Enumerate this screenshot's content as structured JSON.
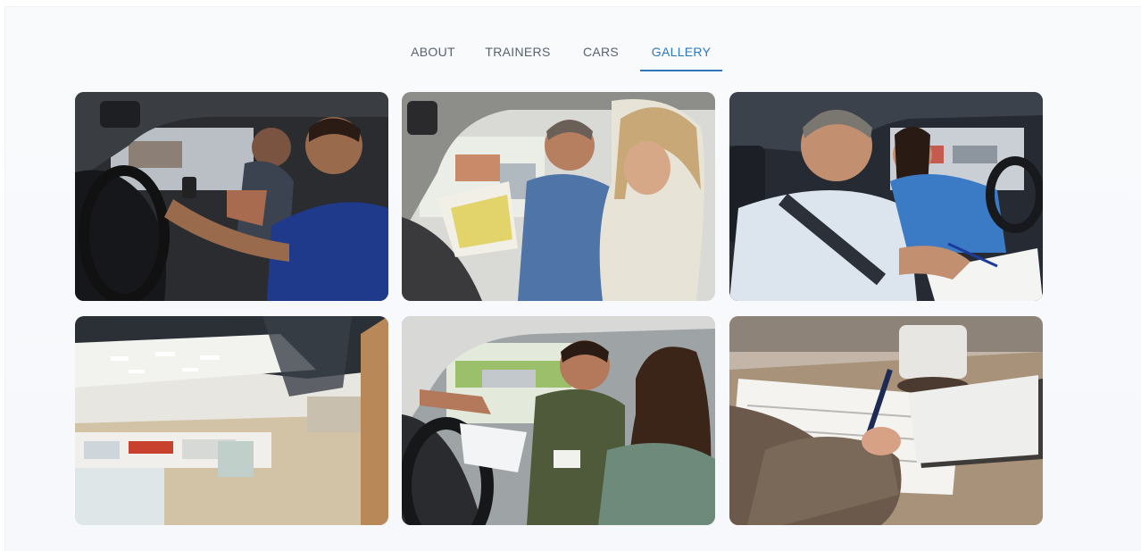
{
  "nav": {
    "tabs": [
      {
        "label": "ABOUT",
        "active": false
      },
      {
        "label": "TRAINERS",
        "active": false
      },
      {
        "label": "CARS",
        "active": false
      },
      {
        "label": "GALLERY",
        "active": true
      }
    ]
  },
  "gallery": {
    "images": [
      {
        "name": "instructor-with-teen-driver-photo"
      },
      {
        "name": "instructor-reviewing-notes-with-student-photo"
      },
      {
        "name": "instructor-grading-driver-photo"
      },
      {
        "name": "office-interior-photo"
      },
      {
        "name": "instructor-pointing-road-photo"
      },
      {
        "name": "writing-notes-with-coffee-photo"
      }
    ]
  },
  "colors": {
    "accent": "#2f78b7",
    "tab_text": "#5a6270",
    "background": "#f7f9fb"
  }
}
